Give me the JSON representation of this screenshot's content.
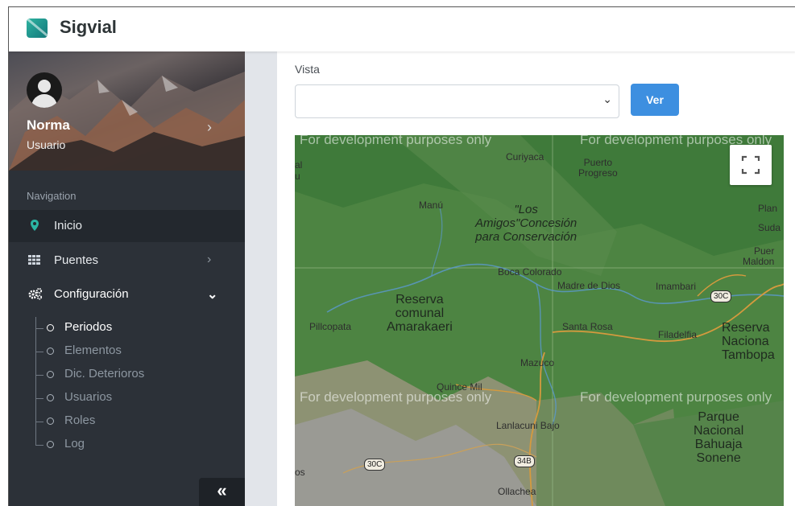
{
  "app": {
    "title": "Sigvial"
  },
  "profile": {
    "name": "Norma",
    "role": "Usuario"
  },
  "navigation": {
    "header": "Navigation",
    "items": [
      {
        "label": "Inicio",
        "icon": "map-pin-icon",
        "active": true
      },
      {
        "label": "Puentes",
        "icon": "grid-icon"
      },
      {
        "label": "Configuración",
        "icon": "cogs-icon",
        "expanded": true
      }
    ],
    "sub_items": [
      {
        "label": "Periodos",
        "current": true
      },
      {
        "label": "Elementos"
      },
      {
        "label": "Dic. Deterioros"
      },
      {
        "label": "Usuarios"
      },
      {
        "label": "Roles"
      },
      {
        "label": "Log"
      }
    ],
    "collapse_label": "«"
  },
  "main": {
    "vista_label": "Vista",
    "select_value": "",
    "ver_button": "Ver"
  },
  "map": {
    "dev_watermark": "For development purposes only",
    "labels": [
      "Curiyaca",
      "Puerto\nProgreso",
      "Manú",
      "\"Los\nAmigos\"Concesión\npara Conservación",
      "Plan",
      "Suda",
      "Puer\nMaldon",
      "Boca Colorado",
      "Madre de Dios",
      "Imambari",
      "Reserva\ncomunal\nAmarakaeri",
      "Pillcopata",
      "Santa Rosa",
      "Filadelfia",
      "Reserva\nNaciona\nTambopa",
      "Mazuco",
      "Quince Mil",
      "Lanlacuni Bajo",
      "Parque\nNacional\nBahuaja\nSonene",
      "Ollachea",
      "os",
      "al\nu"
    ],
    "shields": [
      "30C",
      "30C",
      "34B"
    ]
  },
  "colors": {
    "sidebar_bg": "#2c3138",
    "accent_blue": "#3d8fe0",
    "pin_teal": "#2bb5a3",
    "map_green": "#4a8240"
  }
}
